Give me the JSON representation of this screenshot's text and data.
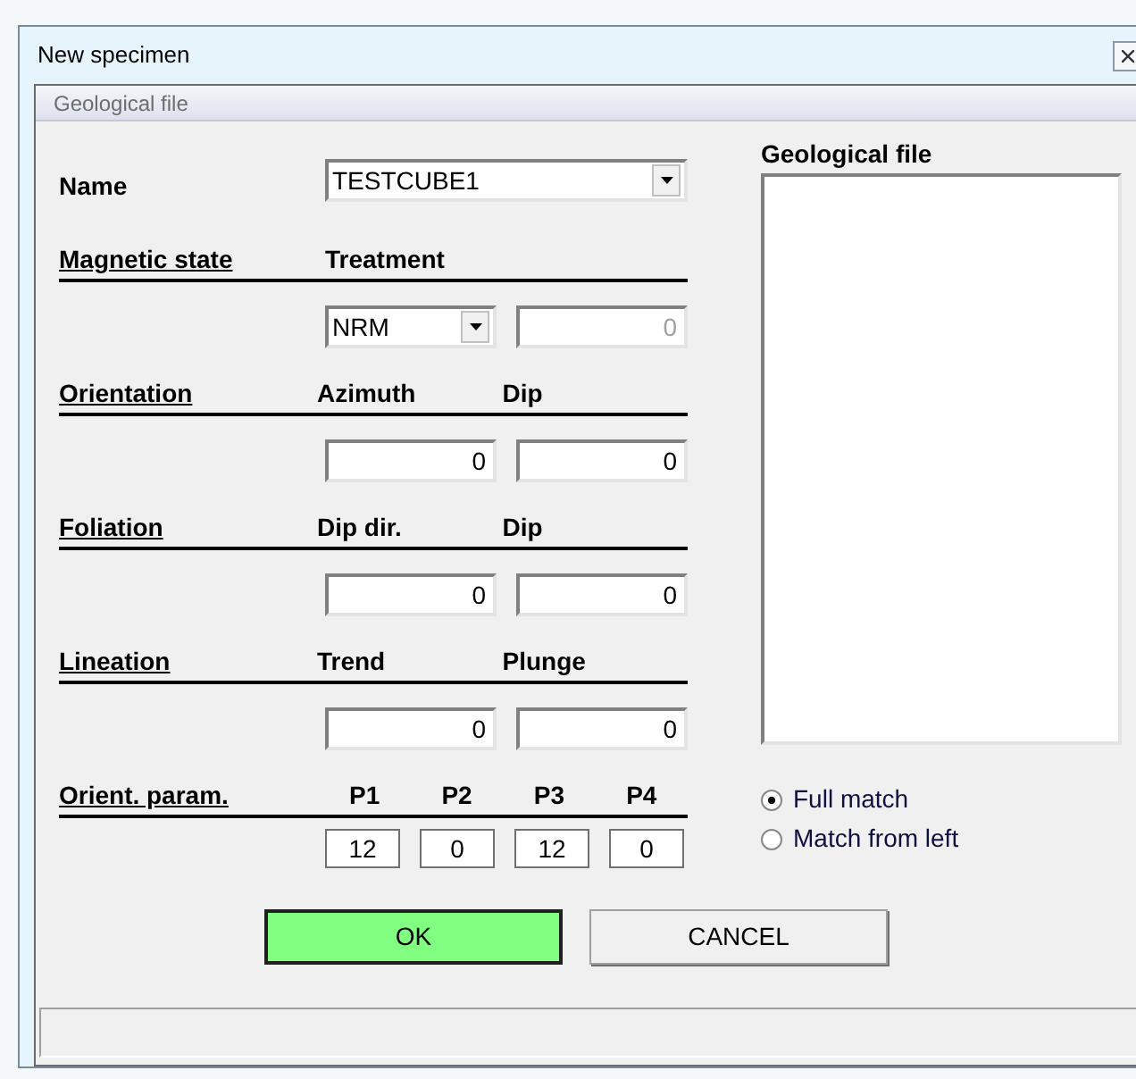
{
  "window": {
    "title": "New specimen"
  },
  "menu": [
    {
      "label": "Geological file"
    }
  ],
  "name": {
    "label": "Name",
    "value": "TESTCUBE1"
  },
  "sections": [
    {
      "label": "Magnetic state",
      "kind": "pair",
      "columns": [
        "Treatment"
      ],
      "fields": [
        {
          "kind": "select",
          "value": "NRM",
          "disabled": false
        },
        {
          "kind": "text",
          "value": "0",
          "disabled": true
        }
      ]
    },
    {
      "label": "Orientation",
      "kind": "pair",
      "columns": [
        "Azimuth",
        "Dip"
      ],
      "fields": [
        {
          "kind": "text",
          "value": "0",
          "disabled": false
        },
        {
          "kind": "text",
          "value": "0",
          "disabled": false
        }
      ]
    },
    {
      "label": "Foliation",
      "kind": "pair",
      "columns": [
        "Dip dir.",
        "Dip"
      ],
      "fields": [
        {
          "kind": "text",
          "value": "0",
          "disabled": false
        },
        {
          "kind": "text",
          "value": "0",
          "disabled": false
        }
      ]
    },
    {
      "label": "Lineation",
      "kind": "pair",
      "columns": [
        "Trend",
        "Plunge"
      ],
      "fields": [
        {
          "kind": "text",
          "value": "0",
          "disabled": false
        },
        {
          "kind": "text",
          "value": "0",
          "disabled": false
        }
      ]
    },
    {
      "label": "Orient. param.",
      "kind": "quad",
      "columns": [
        "P1",
        "P2",
        "P3",
        "P4"
      ],
      "fields": [
        {
          "kind": "small",
          "value": "12",
          "disabled": false
        },
        {
          "kind": "small",
          "value": "0",
          "disabled": false
        },
        {
          "kind": "small",
          "value": "12",
          "disabled": false
        },
        {
          "kind": "small",
          "value": "0",
          "disabled": false
        }
      ]
    }
  ],
  "file_list": {
    "title": "Geological file"
  },
  "match_options": [
    {
      "label": "Full match",
      "selected": true
    },
    {
      "label": "Match from left",
      "selected": false
    }
  ],
  "buttons": [
    {
      "label": "OK",
      "default": true
    },
    {
      "label": "CANCEL",
      "default": false
    }
  ]
}
